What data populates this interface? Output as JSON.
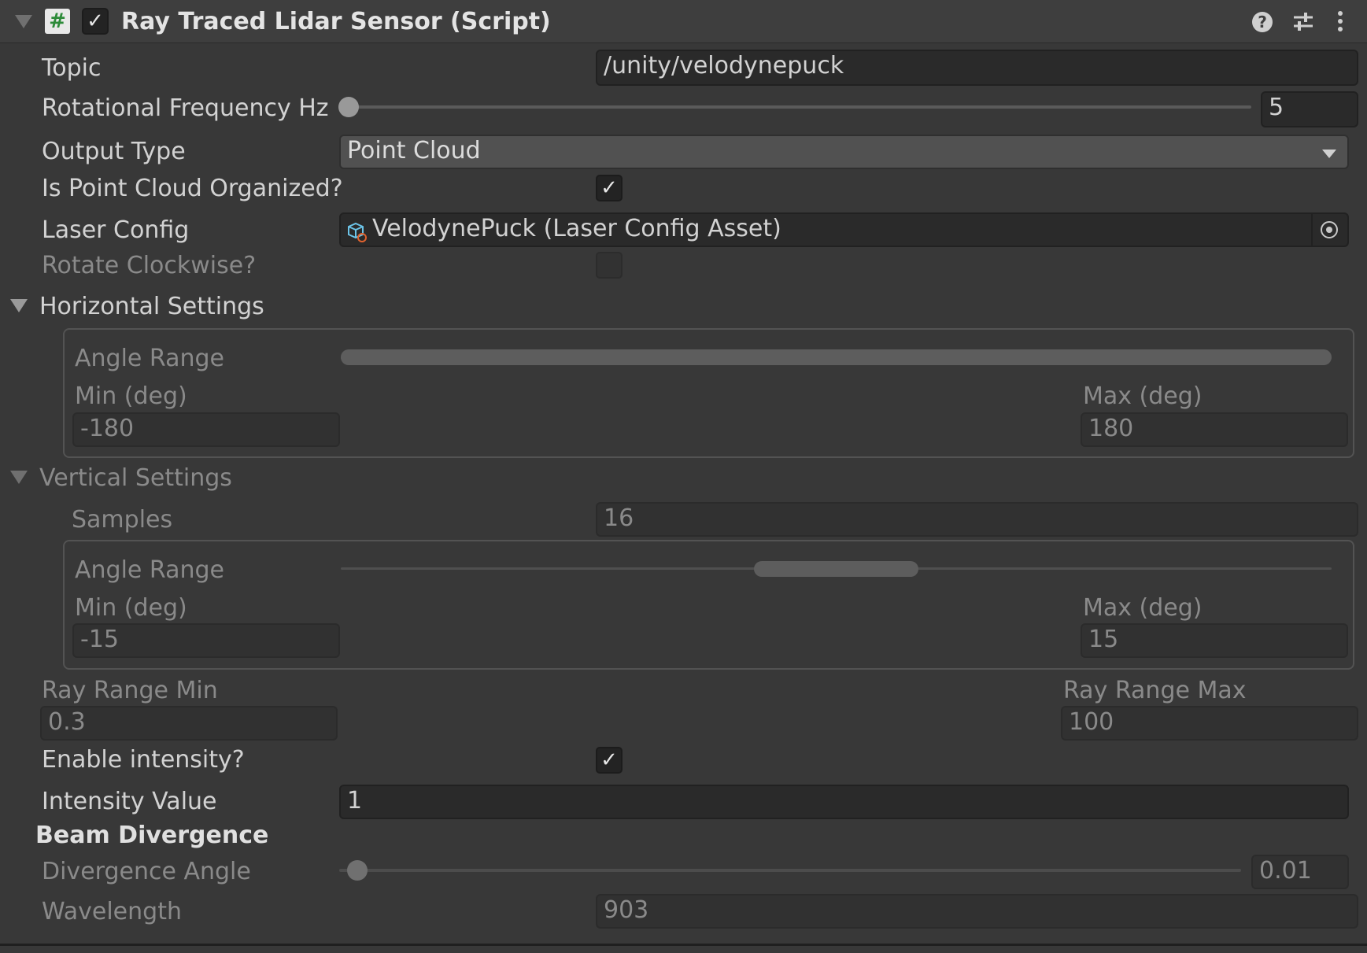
{
  "component": {
    "title": "Ray Traced Lidar Sensor (Script)",
    "script_icon_glyph": "#",
    "enabled_checkmark": "✓",
    "icons": [
      "help-icon",
      "preset-icon",
      "more-icon"
    ]
  },
  "fields": {
    "topic": {
      "label": "Topic",
      "value": "/unity/velodynepuck"
    },
    "rotational_frequency": {
      "label": "Rotational Frequency Hz",
      "value": "5",
      "slider_fraction": 0.0
    },
    "output_type": {
      "label": "Output Type",
      "value": "Point Cloud"
    },
    "organized": {
      "label": "Is Point Cloud Organized?",
      "checked": true,
      "checkmark": "✓"
    },
    "laser_config": {
      "label": "Laser Config",
      "value": "VelodynePuck (Laser Config Asset)"
    },
    "rotate_clockwise": {
      "label": "Rotate Clockwise?",
      "checked": false
    }
  },
  "horizontal": {
    "label": "Horizontal Settings",
    "angle_range_label": "Angle Range",
    "min_label": "Min (deg)",
    "max_label": "Max (deg)",
    "min": "-180",
    "max": "180",
    "range_start": -180,
    "range_end": 180
  },
  "vertical": {
    "label": "Vertical Settings",
    "samples_label": "Samples",
    "samples": "16",
    "angle_range_label": "Angle Range",
    "min_label": "Min (deg)",
    "max_label": "Max (deg)",
    "min": "-15",
    "max": "15",
    "range_start": -15,
    "range_end": 15
  },
  "ray_range": {
    "min_label": "Ray Range Min",
    "min": "0.3",
    "max_label": "Ray Range Max",
    "max": "100"
  },
  "intensity": {
    "enable_label": "Enable intensity?",
    "enabled": true,
    "checkmark": "✓",
    "value_label": "Intensity Value",
    "value": "1"
  },
  "beam": {
    "header": "Beam Divergence",
    "divergence_label": "Divergence Angle",
    "divergence": "0.01",
    "wavelength_label": "Wavelength",
    "wavelength": "903"
  }
}
